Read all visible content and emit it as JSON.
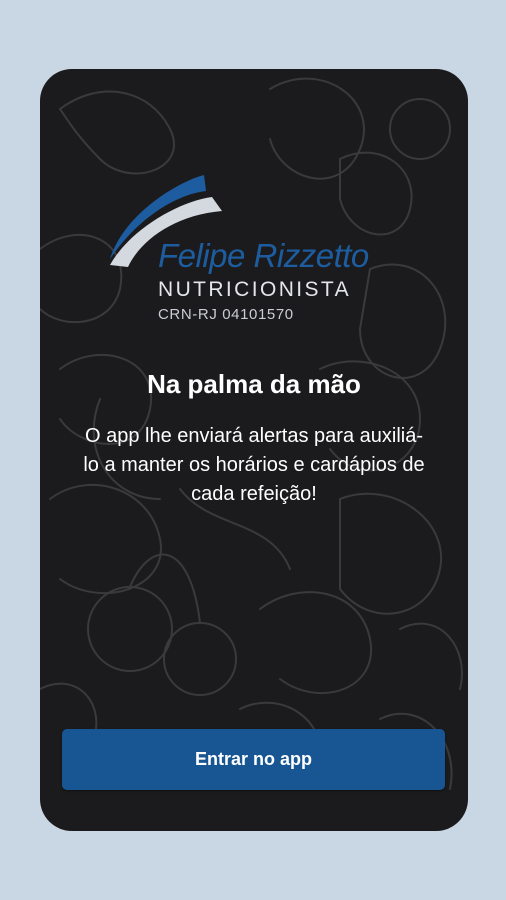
{
  "colors": {
    "page_background": "#c9d6e3",
    "screen_background": "#1b1b1d",
    "brand_blue": "#1d5d9f",
    "button_blue": "#175693",
    "text_white": "#ffffff"
  },
  "logo": {
    "name": "Felipe Rizzetto",
    "title": "NUTRICIONISTA",
    "registration": "CRN-RJ 04101570"
  },
  "onboarding": {
    "headline": "Na palma da mão",
    "description": "O app lhe enviará alertas para auxiliá-lo a manter os horários e cardápios de cada refeição!"
  },
  "actions": {
    "enter_label": "Entrar no app"
  }
}
